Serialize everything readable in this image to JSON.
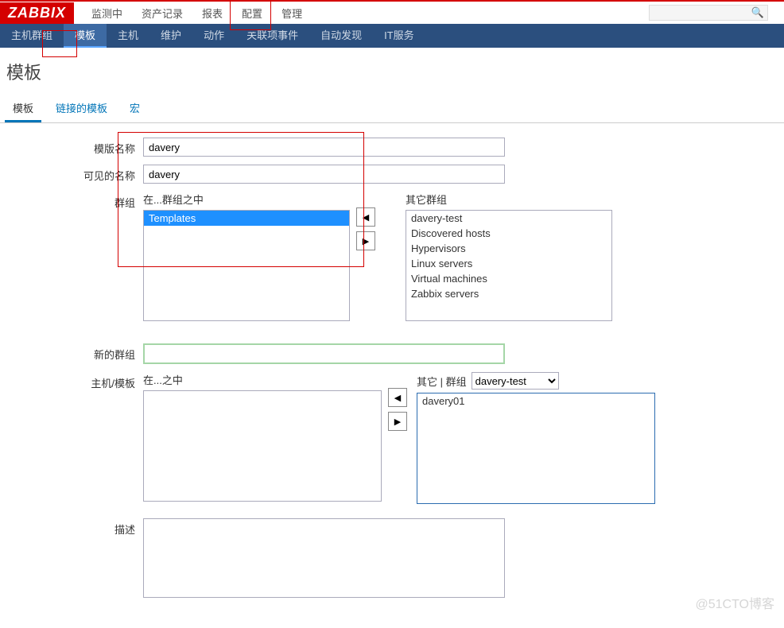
{
  "logo": "ZABBIX",
  "mainNav": {
    "items": [
      "监测中",
      "资产记录",
      "报表",
      "配置",
      "管理"
    ],
    "activeIndex": 3
  },
  "subNav": {
    "items": [
      "主机群组",
      "模板",
      "主机",
      "维护",
      "动作",
      "关联项事件",
      "自动发现",
      "IT服务"
    ],
    "activeIndex": 1
  },
  "pageTitle": "模板",
  "tabs": {
    "items": [
      "模板",
      "链接的模板",
      "宏"
    ],
    "activeIndex": 0
  },
  "form": {
    "templateName": {
      "label": "模版名称",
      "value": "davery"
    },
    "visibleName": {
      "label": "可见的名称",
      "value": "davery"
    },
    "groups": {
      "label": "群组",
      "inLabel": "在...群组之中",
      "otherLabel": "其它群组",
      "inItems": [
        "Templates"
      ],
      "otherItems": [
        "davery-test",
        "Discovered hosts",
        "Hypervisors",
        "Linux servers",
        "Virtual machines",
        "Zabbix servers"
      ]
    },
    "newGroup": {
      "label": "新的群组",
      "value": ""
    },
    "hosts": {
      "label": "主机/模板",
      "inLabel": "在...之中",
      "otherLabel": "其它 | 群组",
      "selectValue": "davery-test",
      "inItems": [],
      "otherItems": [
        "davery01"
      ]
    },
    "description": {
      "label": "描述",
      "value": ""
    }
  },
  "buttons": {
    "left": "◀",
    "right": "▶"
  },
  "watermark": "@51CTO博客"
}
